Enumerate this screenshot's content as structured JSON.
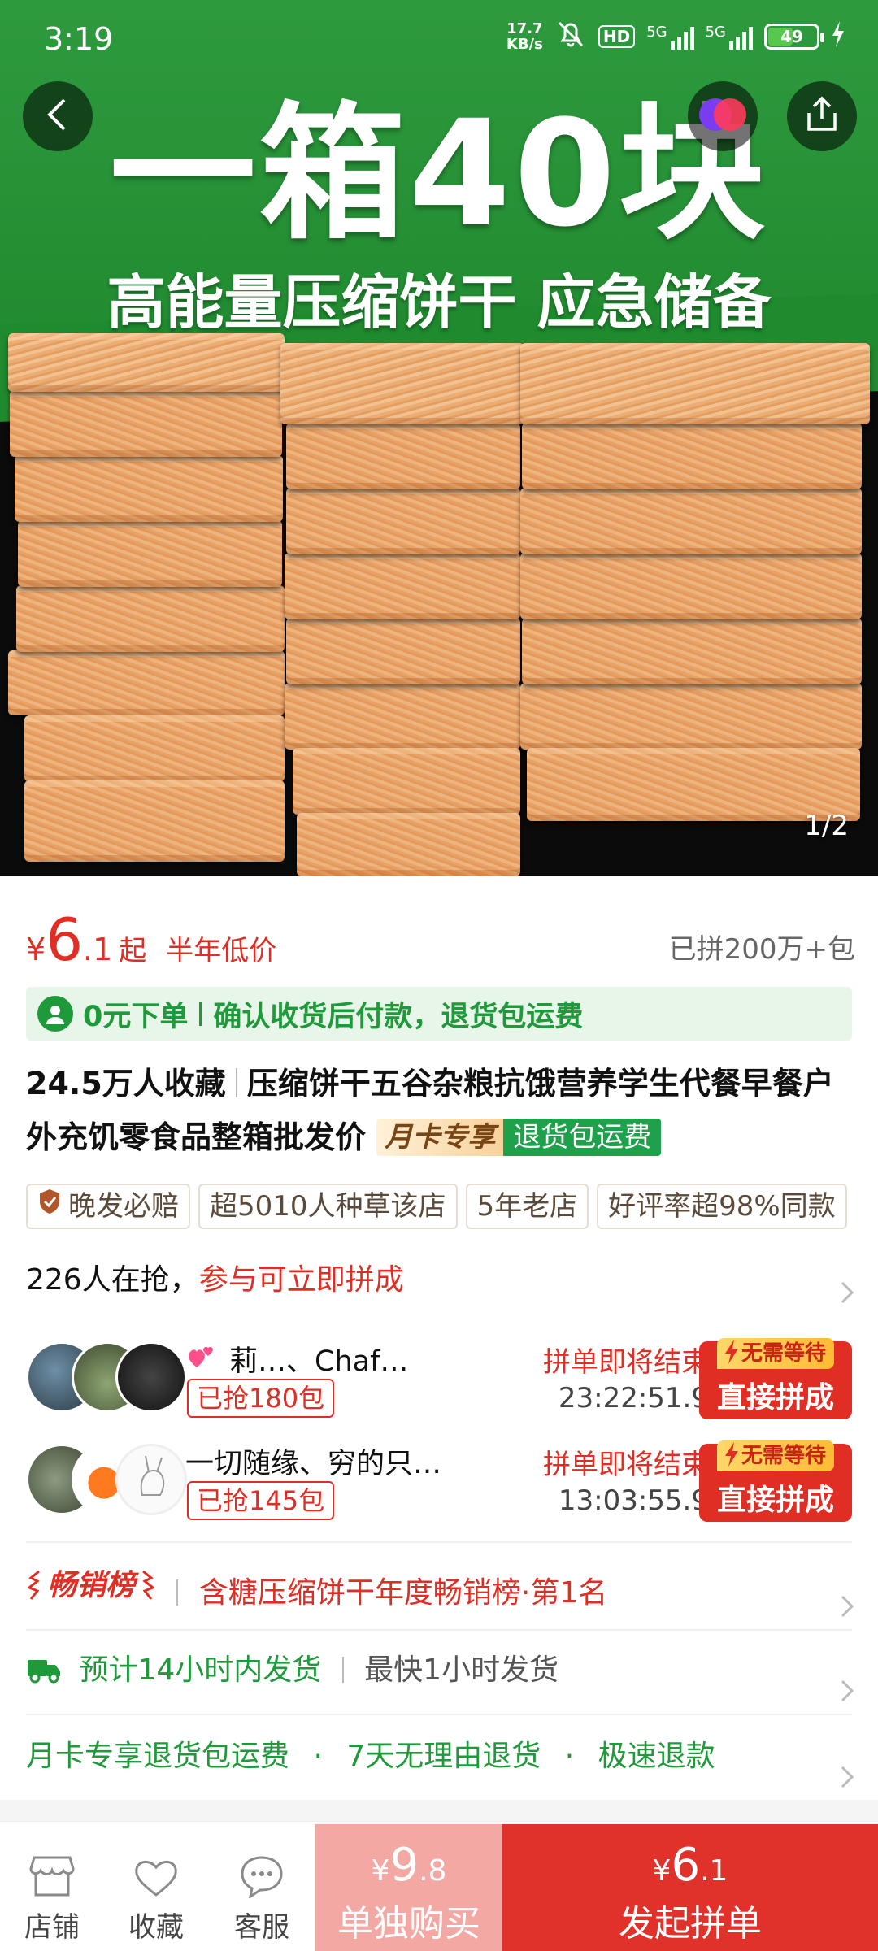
{
  "status_bar": {
    "time": "3:19",
    "net_speed_value": "17.7",
    "net_speed_unit": "KB/s",
    "hd_label": "HD",
    "sig1_label": "5G",
    "sig2_label": "5G",
    "battery": "49"
  },
  "hero": {
    "title": "一箱40块",
    "subtitle": "高能量压缩饼干 应急储备",
    "counter": "1/2"
  },
  "price": {
    "currency": "¥",
    "integer": "6",
    "decimal": ".1",
    "qi": "起",
    "tag": "半年低价",
    "sold": "已拼200万+包"
  },
  "promo": {
    "left": "0元下单",
    "right": "确认收货后付款，退货包运费"
  },
  "title": {
    "favorites": "24.5万人收藏",
    "name": "压缩饼干五谷杂粮抗饿营养学生代餐早餐户外充饥零食品整箱批发价",
    "chip_member": "月卡专享",
    "chip_return": "退货包运费"
  },
  "tags": [
    "晚发必赔",
    "超5010人种草该店",
    "5年老店",
    "好评率超98%同款"
  ],
  "group": {
    "head_count": "226人在抢，",
    "head_hint": "参与可立即拼成",
    "rows": [
      {
        "name": "莉…、Chaf…",
        "got": "已抢180包",
        "end": "拼单即将结束",
        "countdown": "23:22:51.9",
        "badge": "无需等待",
        "button": "直接拼成"
      },
      {
        "name": "一切随缘、穷的只…",
        "got": "已抢145包",
        "end": "拼单即将结束",
        "countdown": "13:03:55.9",
        "badge": "无需等待",
        "button": "直接拼成"
      }
    ]
  },
  "ranking": {
    "badge": "畅销榜",
    "text": "含糖压缩饼干年度畅销榜·第1名"
  },
  "shipping": {
    "eta": "预计14小时内发货",
    "fastest": "最快1小时发货"
  },
  "service": {
    "a": "月卡专享退货包运费",
    "dot": "·",
    "b": "7天无理由退货",
    "c": "极速退款"
  },
  "bottom": {
    "store": "店铺",
    "collect": "收藏",
    "service": "客服",
    "single_currency": "¥",
    "single_int": "9",
    "single_dec": ".8",
    "single_label": "单独购买",
    "group_currency": "¥",
    "group_int": "6",
    "group_dec": ".1",
    "group_label": "发起拼单"
  },
  "colors": {
    "accent_red": "#e02e24",
    "accent_green": "#1f9a3b"
  }
}
